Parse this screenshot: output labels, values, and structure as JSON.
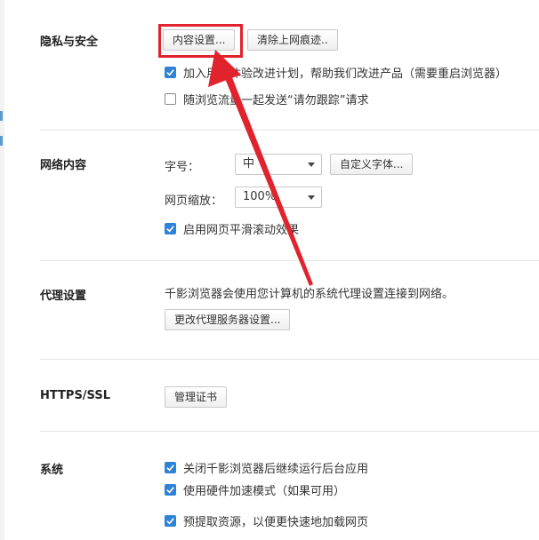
{
  "privacy": {
    "title": "隐私与安全",
    "content_settings_label": "内容设置...",
    "clear_traces_label": "清除上网痕迹..",
    "improve_program_label": "加入用户体验改进计划，帮助我们改进产品（需要重启浏览器）",
    "improve_program_checked": true,
    "do_not_track_label": "随浏览流量一起发送“请勿跟踪”请求",
    "do_not_track_checked": false
  },
  "web_content": {
    "title": "网络内容",
    "font_size_label": "字号：",
    "font_size_value": "中",
    "custom_fonts_label": "自定义字体...",
    "page_zoom_label": "网页缩放：",
    "page_zoom_value": "100%",
    "smooth_scroll_label": "启用网页平滑滚动效果",
    "smooth_scroll_checked": true
  },
  "proxy": {
    "title": "代理设置",
    "description": "千影浏览器会使用您计算机的系统代理设置连接到网络。",
    "change_proxy_label": "更改代理服务器设置..."
  },
  "https": {
    "title": "HTTPS/SSL",
    "manage_certs_label": "管理证书"
  },
  "system": {
    "title": "系统",
    "background_apps_label": "关闭千影浏览器后继续运行后台应用",
    "background_apps_checked": true,
    "hardware_accel_label": "使用硬件加速模式（如果可用）",
    "hardware_accel_checked": true,
    "prefetch_label": "预提取资源，以便更快速地加载网页",
    "prefetch_checked": true
  },
  "annotation": {
    "color": "#e0232d"
  }
}
